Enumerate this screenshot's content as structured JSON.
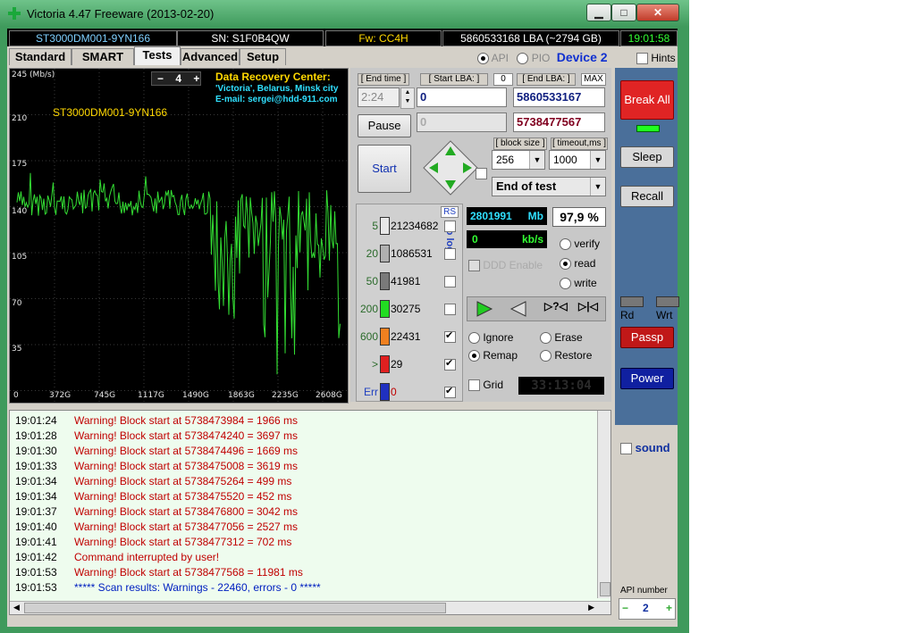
{
  "window": {
    "title": "Victoria 4.47  Freeware (2013-02-20)",
    "minimize": "▁",
    "maximize": "□",
    "close": "✕"
  },
  "infobar": {
    "model": "ST3000DM001-9YN166",
    "serial": "SN: S1F0B4QW",
    "firmware": "Fw: CC4H",
    "lba": "5860533168 LBA (~2794 GB)",
    "clock": "19:01:58"
  },
  "tabs": [
    "Standard",
    "SMART",
    "Tests",
    "Advanced",
    "Setup"
  ],
  "mode": {
    "api": "API",
    "pio": "PIO",
    "device": "Device 2",
    "hints": "Hints"
  },
  "graph": {
    "yticks": [
      "245 (Mb/s)",
      "210",
      "175",
      "140",
      "105",
      "70",
      "35",
      "0"
    ],
    "xticks": [
      "372G",
      "745G",
      "1117G",
      "1490G",
      "1863G",
      "2235G",
      "2608G"
    ],
    "scale_minus": "−",
    "scale_value": "4",
    "scale_plus": "+",
    "drive_label": "ST3000DM001-9YN166",
    "ad_title": "Data Recovery Center:",
    "ad_line1": "'Victoria', Belarus, Minsk city",
    "ad_line2": "E-mail: sergei@hdd-911.com"
  },
  "controls": {
    "end_time_label": "[ End time ]",
    "end_time_value": "2:24",
    "start_lba_label": "[ Start LBA: ]",
    "start_lba_zero": "0",
    "start_lba_value": "0",
    "end_lba_label": "[ End LBA: ]",
    "end_lba_max": "MAX",
    "end_lba_value": "5860533167",
    "current_lba": "0",
    "current_end": "5738477567",
    "pause": "Pause",
    "start": "Start",
    "block_size_label": "[ block size ]",
    "block_size_value": "256",
    "timeout_label": "[ timeout,ms ]",
    "timeout_value": "1000",
    "end_action": "End of test"
  },
  "stats": {
    "rs": "RS",
    "to_log": "to log:",
    "rows": [
      {
        "label": "5",
        "count": "21234682",
        "color": "#e8e8e8",
        "checked": false
      },
      {
        "label": "20",
        "count": "1086531",
        "color": "#b0b0b0",
        "checked": false
      },
      {
        "label": "50",
        "count": "41981",
        "color": "#7a7a7a",
        "checked": false
      },
      {
        "label": "200",
        "count": "30275",
        "color": "#22dd22",
        "checked": false
      },
      {
        "label": "600",
        "count": "22431",
        "color": "#f08020",
        "checked": true
      },
      {
        "label": ">",
        "count": "29",
        "color": "#e02020",
        "checked": true
      },
      {
        "label": "Err",
        "count": "0",
        "color": "#2030c0",
        "checked": true
      }
    ]
  },
  "progress": {
    "mb_value": "2801991",
    "mb_unit": "Mb",
    "percent": "97,9 %",
    "speed_value": "0",
    "speed_unit": "kb/s",
    "ddd": "DDD Enable",
    "verify": "verify",
    "read": "read",
    "write": "write",
    "ignore": "Ignore",
    "erase": "Erase",
    "remap": "Remap",
    "restore": "Restore",
    "grid": "Grid",
    "timer": "33:13:04"
  },
  "right": {
    "break_all": "Break All",
    "sleep": "Sleep",
    "recall": "Recall",
    "rd": "Rd",
    "wrt": "Wrt",
    "passp": "Passp",
    "power": "Power",
    "sound": "sound",
    "api_number_label": "API number",
    "api_number": "2"
  },
  "log": [
    {
      "time": "19:01:24",
      "msg": "Warning! Block start at 5738473984 = 1966 ms",
      "type": "warn"
    },
    {
      "time": "19:01:28",
      "msg": "Warning! Block start at 5738474240 = 3697 ms",
      "type": "warn"
    },
    {
      "time": "19:01:30",
      "msg": "Warning! Block start at 5738474496 = 1669 ms",
      "type": "warn"
    },
    {
      "time": "19:01:33",
      "msg": "Warning! Block start at 5738475008 = 3619 ms",
      "type": "warn"
    },
    {
      "time": "19:01:34",
      "msg": "Warning! Block start at 5738475264 = 499 ms",
      "type": "warn"
    },
    {
      "time": "19:01:34",
      "msg": "Warning! Block start at 5738475520 = 452 ms",
      "type": "warn"
    },
    {
      "time": "19:01:37",
      "msg": "Warning! Block start at 5738476800 = 3042 ms",
      "type": "warn"
    },
    {
      "time": "19:01:40",
      "msg": "Warning! Block start at 5738477056 = 2527 ms",
      "type": "warn"
    },
    {
      "time": "19:01:41",
      "msg": "Warning! Block start at 5738477312 = 702 ms",
      "type": "warn"
    },
    {
      "time": "19:01:42",
      "msg": "Command interrupted by user!",
      "type": "warn"
    },
    {
      "time": "19:01:53",
      "msg": "Warning! Block start at 5738477568 = 11981 ms",
      "type": "warn"
    },
    {
      "time": "19:01:53",
      "msg": "***** Scan results: Warnings - 22460, errors - 0 *****",
      "type": "info"
    }
  ],
  "colors": {
    "warn": "#c00000",
    "info": "#0020c0",
    "graph_line": "#33dd33"
  }
}
